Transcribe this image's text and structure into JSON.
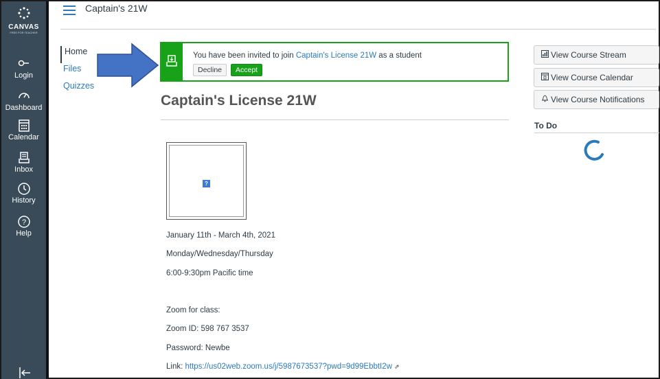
{
  "global_nav": {
    "logo_text": "CANVAS",
    "logo_sub": "FREE FOR TEACHER",
    "items": [
      {
        "label": "Login",
        "icon": "login-icon"
      },
      {
        "label": "Dashboard",
        "icon": "dashboard-icon"
      },
      {
        "label": "Calendar",
        "icon": "calendar-icon"
      },
      {
        "label": "Inbox",
        "icon": "inbox-icon"
      },
      {
        "label": "History",
        "icon": "history-icon"
      },
      {
        "label": "Help",
        "icon": "help-icon"
      }
    ],
    "collapse_icon": "collapse-nav-icon",
    "background": "#394b58"
  },
  "header": {
    "breadcrumb": "Captain's 21W"
  },
  "course_nav": {
    "items": [
      {
        "label": "Home",
        "active": true
      },
      {
        "label": "Files",
        "active": false
      },
      {
        "label": "Quizzes",
        "active": false
      }
    ]
  },
  "invite": {
    "text_before": "You have been invited to join ",
    "course_link": "Captain's License 21W",
    "text_after": " as a student",
    "decline_label": "Decline",
    "accept_label": "Accept",
    "accent": "#18a21a"
  },
  "main": {
    "title": "Captain's License 21W",
    "image_icon": "broken-image-icon",
    "broken_glyph": "?",
    "lines": {
      "dates": "January 11th - March 4th, 2021",
      "days": "Monday/Wednesday/Thursday",
      "time": "6:00-9:30pm Pacific time",
      "zoom_heading": "Zoom for class:",
      "zoom_id": "Zoom ID: 598 767 3537",
      "password": "Password: Newbe",
      "link_label": "Link: ",
      "link_url": "https://us02web.zoom.us/j/5987673537?pwd=9d99EbbtI2w"
    }
  },
  "sidebar": {
    "buttons": [
      {
        "label": "View Course Stream",
        "icon": "stream-icon"
      },
      {
        "label": "View Course Calendar",
        "icon": "calendar-icon"
      },
      {
        "label": "View Course Notifications",
        "icon": "bell-icon"
      }
    ],
    "todo_title": "To Do"
  },
  "colors": {
    "link": "#2b7abc",
    "text": "#2d3b45",
    "arrow": "#4472c4"
  }
}
